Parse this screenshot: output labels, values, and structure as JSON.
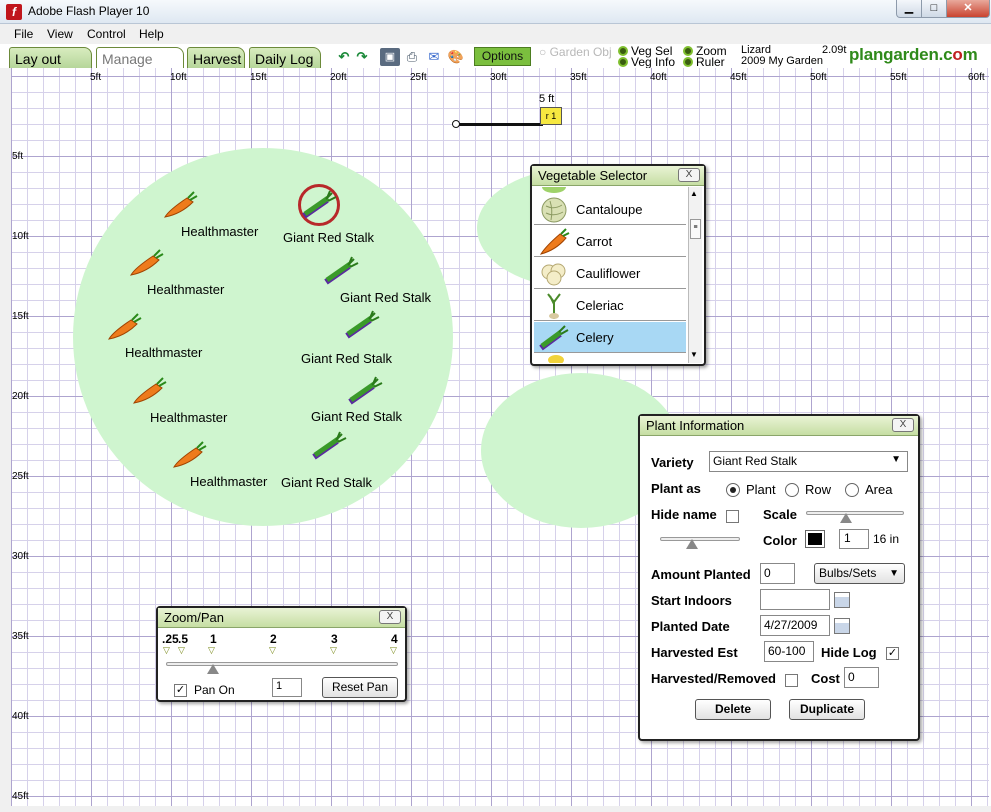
{
  "window": {
    "title": "Adobe Flash Player 10"
  },
  "menu": [
    "File",
    "View",
    "Control",
    "Help"
  ],
  "tabs": [
    "Lay out Plot",
    "Manage Veg",
    "Harvest",
    "Daily Log"
  ],
  "toolbar": {
    "options_label": "Options",
    "garden_obj": "Garden Obj",
    "veg_sel": "Veg Sel",
    "veg_info": "Veg Info",
    "zoom": "Zoom",
    "ruler": "Ruler",
    "user": "Lizard",
    "garden_name": "2009 My Garden",
    "version": "2.09t",
    "brand_left": "plangarden.c",
    "brand_o": "o",
    "brand_right": "m"
  },
  "ruler": {
    "x_ticks": [
      "5ft",
      "10ft",
      "15ft",
      "20ft",
      "25ft",
      "30ft",
      "35ft",
      "40ft",
      "45ft",
      "50ft",
      "55ft",
      "60ft"
    ],
    "y_ticks": [
      "5ft",
      "10ft",
      "15ft",
      "20ft",
      "25ft",
      "30ft",
      "35ft",
      "40ft",
      "45ft"
    ],
    "measure_label": "5 ft"
  },
  "plants": {
    "carrot": "Healthmaster",
    "celery": "Giant Red Stalk"
  },
  "vegetable_selector": {
    "title": "Vegetable Selector",
    "close": "X",
    "items": [
      "Cantaloupe",
      "Carrot",
      "Cauliflower",
      "Celeriac",
      "Celery"
    ],
    "selected": "Celery"
  },
  "zoom_pan": {
    "title": "Zoom/Pan",
    "close": "X",
    "marks": [
      ".25",
      ".5",
      "1",
      "2",
      "3",
      "4"
    ],
    "pan_on_label": "Pan On",
    "pan_value": "1",
    "reset_label": "Reset Pan"
  },
  "plant_info": {
    "title": "Plant Information",
    "close": "X",
    "variety_label": "Variety",
    "variety_value": "Giant Red Stalk",
    "plant_as_label": "Plant as",
    "plant_as_options": [
      "Plant",
      "Row",
      "Area"
    ],
    "hide_name_label": "Hide name",
    "scale_label": "Scale",
    "color_label": "Color",
    "color_count": "1",
    "size_unit": "16 in",
    "amount_label": "Amount Planted",
    "amount_value": "0",
    "amount_unit": "Bulbs/Sets",
    "start_indoors_label": "Start Indoors",
    "start_indoors_value": "",
    "planted_date_label": "Planted Date",
    "planted_date_value": "4/27/2009",
    "harvested_est_label": "Harvested Est",
    "harvested_est_value": "60-100",
    "hide_log_label": "Hide Log",
    "harvested_removed_label": "Harvested/Removed",
    "cost_label": "Cost",
    "cost_value": "0",
    "delete_label": "Delete",
    "duplicate_label": "Duplicate"
  }
}
